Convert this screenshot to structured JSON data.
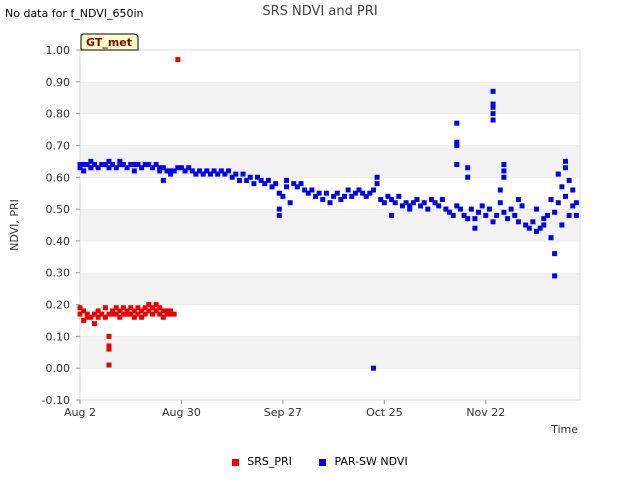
{
  "status_text": "No data for f_NDVI_650in",
  "badge": "GT_met",
  "chart_data": {
    "type": "scatter",
    "title": "SRS NDVI and PRI",
    "xlabel": "Time",
    "ylabel": "NDVI, PRI",
    "ylim": [
      -0.1,
      1.0
    ],
    "xlim": [
      "Aug 2",
      "Dec 18"
    ],
    "yticks": [
      "-0.10",
      "0.00",
      "0.10",
      "0.20",
      "0.30",
      "0.40",
      "0.50",
      "0.60",
      "0.70",
      "0.80",
      "0.90",
      "1.00"
    ],
    "xticks": [
      "Aug 2",
      "Aug 30",
      "Sep 27",
      "Oct 25",
      "Nov 22"
    ],
    "grid": "horizontal bands",
    "legend_position": "bottom",
    "series": [
      {
        "name": "SRS_PRI",
        "color": "#ee0000",
        "points": [
          [
            "Aug 2",
            0.19
          ],
          [
            "Aug 2",
            0.17
          ],
          [
            "Aug 3",
            0.18
          ],
          [
            "Aug 3",
            0.15
          ],
          [
            "Aug 4",
            0.16
          ],
          [
            "Aug 4",
            0.17
          ],
          [
            "Aug 5",
            0.16
          ],
          [
            "Aug 6",
            0.17
          ],
          [
            "Aug 6",
            0.14
          ],
          [
            "Aug 7",
            0.16
          ],
          [
            "Aug 7",
            0.18
          ],
          [
            "Aug 8",
            0.17
          ],
          [
            "Aug 9",
            0.19
          ],
          [
            "Aug 9",
            0.16
          ],
          [
            "Aug 10",
            0.17
          ],
          [
            "Aug 10",
            0.01
          ],
          [
            "Aug 10",
            0.06
          ],
          [
            "Aug 10",
            0.07
          ],
          [
            "Aug 10",
            0.1
          ],
          [
            "Aug 11",
            0.18
          ],
          [
            "Aug 11",
            0.17
          ],
          [
            "Aug 12",
            0.19
          ],
          [
            "Aug 12",
            0.17
          ],
          [
            "Aug 13",
            0.18
          ],
          [
            "Aug 13",
            0.16
          ],
          [
            "Aug 14",
            0.17
          ],
          [
            "Aug 14",
            0.19
          ],
          [
            "Aug 15",
            0.18
          ],
          [
            "Aug 15",
            0.17
          ],
          [
            "Aug 16",
            0.17
          ],
          [
            "Aug 16",
            0.19
          ],
          [
            "Aug 17",
            0.18
          ],
          [
            "Aug 17",
            0.16
          ],
          [
            "Aug 18",
            0.19
          ],
          [
            "Aug 18",
            0.17
          ],
          [
            "Aug 19",
            0.18
          ],
          [
            "Aug 19",
            0.16
          ],
          [
            "Aug 20",
            0.17
          ],
          [
            "Aug 20",
            0.19
          ],
          [
            "Aug 21",
            0.18
          ],
          [
            "Aug 21",
            0.2
          ],
          [
            "Aug 22",
            0.19
          ],
          [
            "Aug 22",
            0.17
          ],
          [
            "Aug 23",
            0.18
          ],
          [
            "Aug 23",
            0.2
          ],
          [
            "Aug 24",
            0.17
          ],
          [
            "Aug 24",
            0.19
          ],
          [
            "Aug 25",
            0.18
          ],
          [
            "Aug 25",
            0.16
          ],
          [
            "Aug 26",
            0.17
          ],
          [
            "Aug 26",
            0.18
          ],
          [
            "Aug 27",
            0.17
          ],
          [
            "Aug 27",
            0.18
          ],
          [
            "Aug 28",
            0.17
          ],
          [
            "Aug 29",
            0.97
          ]
        ]
      },
      {
        "name": "PAR-SW NDVI",
        "color": "#0000ee",
        "points": [
          [
            "Aug 2",
            0.64
          ],
          [
            "Aug 2",
            0.63
          ],
          [
            "Aug 3",
            0.62
          ],
          [
            "Aug 3",
            0.64
          ],
          [
            "Aug 4",
            0.64
          ],
          [
            "Aug 5",
            0.65
          ],
          [
            "Aug 5",
            0.63
          ],
          [
            "Aug 6",
            0.64
          ],
          [
            "Aug 7",
            0.63
          ],
          [
            "Aug 8",
            0.64
          ],
          [
            "Aug 9",
            0.64
          ],
          [
            "Aug 10",
            0.65
          ],
          [
            "Aug 10",
            0.63
          ],
          [
            "Aug 11",
            0.64
          ],
          [
            "Aug 12",
            0.63
          ],
          [
            "Aug 13",
            0.65
          ],
          [
            "Aug 13",
            0.64
          ],
          [
            "Aug 14",
            0.64
          ],
          [
            "Aug 15",
            0.63
          ],
          [
            "Aug 16",
            0.64
          ],
          [
            "Aug 17",
            0.62
          ],
          [
            "Aug 17",
            0.64
          ],
          [
            "Aug 18",
            0.64
          ],
          [
            "Aug 19",
            0.63
          ],
          [
            "Aug 20",
            0.64
          ],
          [
            "Aug 21",
            0.64
          ],
          [
            "Aug 22",
            0.63
          ],
          [
            "Aug 23",
            0.64
          ],
          [
            "Aug 24",
            0.62
          ],
          [
            "Aug 24",
            0.63
          ],
          [
            "Aug 25",
            0.59
          ],
          [
            "Aug 25",
            0.63
          ],
          [
            "Aug 26",
            0.62
          ],
          [
            "Aug 27",
            0.61
          ],
          [
            "Aug 27",
            0.62
          ],
          [
            "Aug 28",
            0.62
          ],
          [
            "Aug 29",
            0.63
          ],
          [
            "Aug 30",
            0.63
          ],
          [
            "Aug 31",
            0.62
          ],
          [
            "Sep 1",
            0.63
          ],
          [
            "Sep 2",
            0.62
          ],
          [
            "Sep 3",
            0.61
          ],
          [
            "Sep 4",
            0.62
          ],
          [
            "Sep 5",
            0.61
          ],
          [
            "Sep 6",
            0.62
          ],
          [
            "Sep 7",
            0.61
          ],
          [
            "Sep 8",
            0.62
          ],
          [
            "Sep 9",
            0.61
          ],
          [
            "Sep 10",
            0.62
          ],
          [
            "Sep 11",
            0.61
          ],
          [
            "Sep 12",
            0.62
          ],
          [
            "Sep 13",
            0.6
          ],
          [
            "Sep 14",
            0.61
          ],
          [
            "Sep 15",
            0.59
          ],
          [
            "Sep 16",
            0.61
          ],
          [
            "Sep 17",
            0.59
          ],
          [
            "Sep 18",
            0.6
          ],
          [
            "Sep 19",
            0.58
          ],
          [
            "Sep 20",
            0.6
          ],
          [
            "Sep 21",
            0.59
          ],
          [
            "Sep 22",
            0.58
          ],
          [
            "Sep 23",
            0.59
          ],
          [
            "Sep 24",
            0.57
          ],
          [
            "Sep 25",
            0.58
          ],
          [
            "Sep 26",
            0.55
          ],
          [
            "Sep 26",
            0.5
          ],
          [
            "Sep 26",
            0.48
          ],
          [
            "Sep 27",
            0.54
          ],
          [
            "Sep 28",
            0.59
          ],
          [
            "Sep 28",
            0.57
          ],
          [
            "Sep 29",
            0.52
          ],
          [
            "Sep 30",
            0.58
          ],
          [
            "Oct 1",
            0.57
          ],
          [
            "Oct 2",
            0.58
          ],
          [
            "Oct 3",
            0.56
          ],
          [
            "Oct 4",
            0.55
          ],
          [
            "Oct 5",
            0.56
          ],
          [
            "Oct 6",
            0.54
          ],
          [
            "Oct 7",
            0.55
          ],
          [
            "Oct 8",
            0.53
          ],
          [
            "Oct 9",
            0.55
          ],
          [
            "Oct 10",
            0.52
          ],
          [
            "Oct 11",
            0.54
          ],
          [
            "Oct 12",
            0.55
          ],
          [
            "Oct 13",
            0.53
          ],
          [
            "Oct 14",
            0.54
          ],
          [
            "Oct 15",
            0.56
          ],
          [
            "Oct 16",
            0.54
          ],
          [
            "Oct 17",
            0.55
          ],
          [
            "Oct 18",
            0.56
          ],
          [
            "Oct 19",
            0.55
          ],
          [
            "Oct 20",
            0.54
          ],
          [
            "Oct 21",
            0.55
          ],
          [
            "Oct 22",
            0.56
          ],
          [
            "Oct 22",
            0.0
          ],
          [
            "Oct 23",
            0.6
          ],
          [
            "Oct 23",
            0.58
          ],
          [
            "Oct 24",
            0.53
          ],
          [
            "Oct 25",
            0.52
          ],
          [
            "Oct 26",
            0.54
          ],
          [
            "Oct 27",
            0.48
          ],
          [
            "Oct 27",
            0.53
          ],
          [
            "Oct 28",
            0.52
          ],
          [
            "Oct 29",
            0.54
          ],
          [
            "Oct 30",
            0.51
          ],
          [
            "Oct 31",
            0.52
          ],
          [
            "Nov 1",
            0.5
          ],
          [
            "Nov 1",
            0.51
          ],
          [
            "Nov 2",
            0.52
          ],
          [
            "Nov 3",
            0.53
          ],
          [
            "Nov 4",
            0.51
          ],
          [
            "Nov 5",
            0.52
          ],
          [
            "Nov 6",
            0.5
          ],
          [
            "Nov 7",
            0.53
          ],
          [
            "Nov 8",
            0.52
          ],
          [
            "Nov 9",
            0.51
          ],
          [
            "Nov 10",
            0.53
          ],
          [
            "Nov 11",
            0.5
          ],
          [
            "Nov 12",
            0.49
          ],
          [
            "Nov 13",
            0.48
          ],
          [
            "Nov 14",
            0.51
          ],
          [
            "Nov 14",
            0.77
          ],
          [
            "Nov 14",
            0.71
          ],
          [
            "Nov 14",
            0.7
          ],
          [
            "Nov 14",
            0.64
          ],
          [
            "Nov 15",
            0.5
          ],
          [
            "Nov 16",
            0.48
          ],
          [
            "Nov 17",
            0.6
          ],
          [
            "Nov 17",
            0.63
          ],
          [
            "Nov 17",
            0.47
          ],
          [
            "Nov 18",
            0.5
          ],
          [
            "Nov 19",
            0.47
          ],
          [
            "Nov 19",
            0.44
          ],
          [
            "Nov 20",
            0.49
          ],
          [
            "Nov 21",
            0.51
          ],
          [
            "Nov 22",
            0.48
          ],
          [
            "Nov 23",
            0.5
          ],
          [
            "Nov 24",
            0.87
          ],
          [
            "Nov 24",
            0.83
          ],
          [
            "Nov 24",
            0.82
          ],
          [
            "Nov 24",
            0.8
          ],
          [
            "Nov 24",
            0.78
          ],
          [
            "Nov 24",
            0.46
          ],
          [
            "Nov 25",
            0.48
          ],
          [
            "Nov 26",
            0.56
          ],
          [
            "Nov 26",
            0.52
          ],
          [
            "Nov 27",
            0.64
          ],
          [
            "Nov 27",
            0.62
          ],
          [
            "Nov 27",
            0.6
          ],
          [
            "Nov 27",
            0.49
          ],
          [
            "Nov 28",
            0.47
          ],
          [
            "Nov 29",
            0.5
          ],
          [
            "Nov 30",
            0.48
          ],
          [
            "Dec 1",
            0.46
          ],
          [
            "Dec 1",
            0.53
          ],
          [
            "Dec 2",
            0.51
          ],
          [
            "Dec 3",
            0.45
          ],
          [
            "Dec 4",
            0.44
          ],
          [
            "Dec 5",
            0.46
          ],
          [
            "Dec 6",
            0.43
          ],
          [
            "Dec 6",
            0.5
          ],
          [
            "Dec 7",
            0.44
          ],
          [
            "Dec 8",
            0.47
          ],
          [
            "Dec 8",
            0.45
          ],
          [
            "Dec 9",
            0.48
          ],
          [
            "Dec 10",
            0.41
          ],
          [
            "Dec 10",
            0.53
          ],
          [
            "Dec 11",
            0.36
          ],
          [
            "Dec 11",
            0.29
          ],
          [
            "Dec 11",
            0.49
          ],
          [
            "Dec 12",
            0.61
          ],
          [
            "Dec 12",
            0.52
          ],
          [
            "Dec 13",
            0.57
          ],
          [
            "Dec 13",
            0.45
          ],
          [
            "Dec 14",
            0.65
          ],
          [
            "Dec 14",
            0.63
          ],
          [
            "Dec 14",
            0.54
          ],
          [
            "Dec 15",
            0.59
          ],
          [
            "Dec 15",
            0.48
          ],
          [
            "Dec 16",
            0.56
          ],
          [
            "Dec 16",
            0.51
          ],
          [
            "Dec 17",
            0.52
          ],
          [
            "Dec 17",
            0.48
          ]
        ]
      }
    ]
  }
}
